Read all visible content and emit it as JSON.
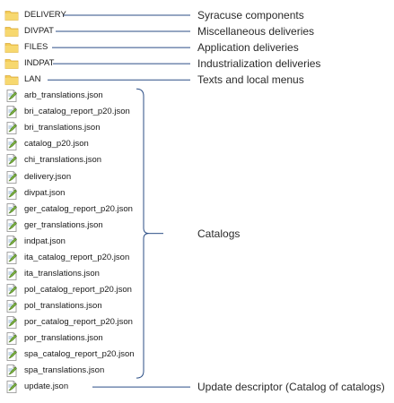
{
  "folders": [
    {
      "name": "DELIVERY",
      "description": "Syracuse components"
    },
    {
      "name": "DIVPAT",
      "description": "Miscellaneous deliveries"
    },
    {
      "name": "FILES",
      "description": "Application deliveries"
    },
    {
      "name": "INDPAT",
      "description": "Industrialization deliveries"
    },
    {
      "name": "LAN",
      "description": "Texts and local menus"
    }
  ],
  "catalog_files": [
    "arb_translations.json",
    "bri_catalog_report_p20.json",
    "bri_translations.json",
    "catalog_p20.json",
    "chi_translations.json",
    "delivery.json",
    "divpat.json",
    "ger_catalog_report_p20.json",
    "ger_translations.json",
    "indpat.json",
    "ita_catalog_report_p20.json",
    "ita_translations.json",
    "pol_catalog_report_p20.json",
    "pol_translations.json",
    "por_catalog_report_p20.json",
    "por_translations.json",
    "spa_catalog_report_p20.json",
    "spa_translations.json"
  ],
  "catalogs_label": "Catalogs",
  "update_file": {
    "name": "update.json",
    "description": "Update descriptor (Catalog of catalogs)"
  },
  "icons": {
    "folder": "folder-icon",
    "file": "json-file-icon"
  },
  "colors": {
    "folder": "#f4cc57",
    "line": "#2b4e86",
    "text": "#1a1a1a"
  }
}
